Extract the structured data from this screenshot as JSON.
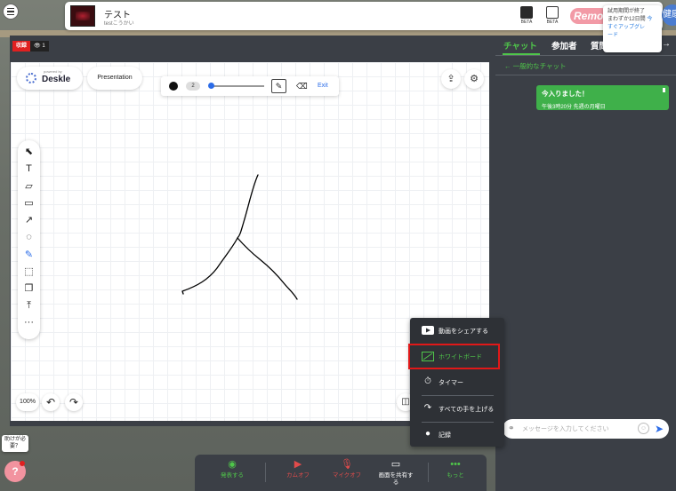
{
  "room": {
    "title": "テスト",
    "subtitle": "testこうかい"
  },
  "header": {
    "beta_label_1": "BETA",
    "beta_label_2": "BETA",
    "brand_name": "Remo",
    "trial": {
      "line1": "試用期間が終了",
      "line2": "まわずか12日間",
      "link1": "今",
      "link2": "すぐアップグレ",
      "link3": "ード"
    },
    "health_button": "健康"
  },
  "stage": {
    "live_label": "収録",
    "viewer_count": "1"
  },
  "whiteboard": {
    "powered_by": "powered by",
    "brand": "Deskle",
    "presentation_button": "Presentation",
    "pen_size": "2",
    "pen_color": "#111111",
    "exit_label": "Exit",
    "zoom_level": "100%",
    "tools": [
      "select",
      "text",
      "sticky-note",
      "rectangle",
      "arrow",
      "comment",
      "pen",
      "marquee-select",
      "frame",
      "upload",
      "more"
    ]
  },
  "chat": {
    "tabs": [
      "チャット",
      "参加者",
      "質問"
    ],
    "back_label": "一般的なチャット",
    "messages": [
      {
        "text": "今入りました！",
        "time": "午後3時20分 先週の月曜日"
      }
    ],
    "input_placeholder": "メッセージを入力してください"
  },
  "more_menu": {
    "items": [
      {
        "icon": "youtube-icon",
        "label": "動画をシェアする"
      },
      {
        "icon": "whiteboard-icon",
        "label": "ホワイトボード"
      },
      {
        "icon": "timer-icon",
        "label": "タイマー"
      },
      {
        "icon": "raise-hand-icon",
        "label": "すべての手を上げる"
      },
      {
        "icon": "record-icon",
        "label": "記録"
      }
    ]
  },
  "controls": {
    "present": "発表する",
    "camera_off": "カムオフ",
    "mic_off": "マイクオフ",
    "share_screen_line1": "画面を共有す",
    "share_screen_line2": "る",
    "more": "もっと"
  },
  "help": {
    "line1": "助けが必",
    "line2": "要？"
  },
  "colors": {
    "accent_green": "#4fc64a",
    "panel_dark": "#3b3f46",
    "danger_red": "#e02020",
    "link_blue": "#2b6ce8"
  }
}
